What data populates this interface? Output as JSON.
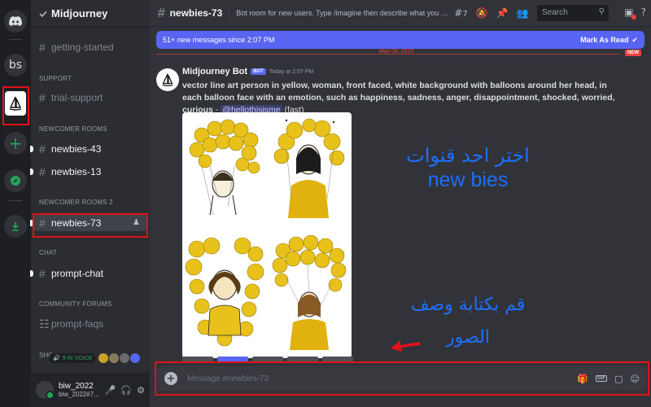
{
  "rail": {
    "bs_label": "bs"
  },
  "server": {
    "name": "Midjourney"
  },
  "sidebar": {
    "channels": [
      {
        "label": "getting-started"
      },
      {
        "label": "trial-support"
      },
      {
        "label": "newbies-43"
      },
      {
        "label": "newbies-13"
      },
      {
        "label": "newbies-73"
      },
      {
        "label": "prompt-chat"
      },
      {
        "label": "prompt-faqs"
      }
    ],
    "categories": [
      "SUPPORT",
      "NEWCOMER ROOMS",
      "NEWCOMER ROOMS 2",
      "CHAT",
      "COMMUNITY FORUMS"
    ],
    "voice_text": "9 IN VOICE",
    "truncated_category": "SHO"
  },
  "user": {
    "name": "biw_2022",
    "tag": "biw_2022#7..."
  },
  "topbar": {
    "channel": "newbies-73",
    "topic": "Bot room for new users. Type /imagine then describe what you want to draw...",
    "thread_count": "7",
    "search_placeholder": "Search"
  },
  "banner": {
    "text": "51+ new messages since 2:07 PM",
    "action": "Mark As Read",
    "date_peek": "May 09, 2023",
    "new_pill": "NEW"
  },
  "message": {
    "author": "Midjourney Bot",
    "badge": "BOT",
    "time": "Today at 2:07 PM",
    "prompt": "vector line art person in yellow, woman, front faced, white background with balloons around her head, in each balloon face with an emotion, such as happiness, sadness, anger, disappointment, shocked, worried, curious",
    "separator": " - ",
    "mention": "@hellothisisme",
    "mode": " (fast)"
  },
  "annotations": {
    "choose_channel_line1": "اختر احد قنوات",
    "choose_channel_line2": "new bies",
    "write_description_line1": "قم بكتابة وصف",
    "write_description_line2": "الصور"
  },
  "composer": {
    "placeholder": "Message #newbies-73"
  },
  "icons": {
    "rail": [
      "discord-icon",
      "midjourney-icon",
      "add-server-icon",
      "explore-icon",
      "download-icon"
    ],
    "topbar": [
      "threads-icon",
      "mute-icon",
      "pin-icon",
      "members-icon",
      "search-icon",
      "inbox-icon",
      "help-icon"
    ],
    "composer": [
      "gift-icon",
      "gif-icon",
      "sticker-icon",
      "emoji-icon"
    ]
  },
  "colors": {
    "accent": "#5865f2",
    "highlight_frame": "#e0121a",
    "annotation_text": "#1d6fff",
    "online": "#23a55a"
  }
}
